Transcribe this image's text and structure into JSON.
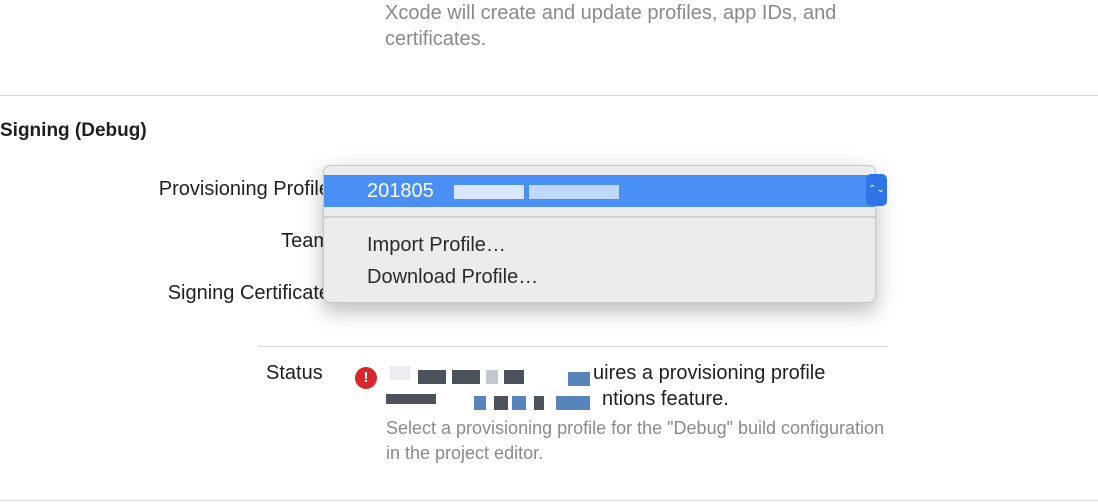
{
  "top_note": "Xcode will create and update profiles, app IDs, and certificates.",
  "section": {
    "title": "Signing (Debug)"
  },
  "rows": {
    "provisioning_profile_label": "Provisioning Profile",
    "team_label": "Team",
    "signing_certificate_label": "Signing Certificate"
  },
  "popup": {
    "selected": "201805",
    "items": [
      "Import Profile…",
      "Download Profile…"
    ]
  },
  "status": {
    "label": "Status",
    "error_icon": "!",
    "message_tail_1": "uires a provisioning profile",
    "message_tail_2": "ntions feature.",
    "hint": "Select a provisioning profile for the \"Debug\" build configuration in the project editor."
  },
  "colors": {
    "menu_highlight": "#4a8ff3",
    "error": "#d9262b",
    "secondary_text": "#8a8a8a"
  }
}
